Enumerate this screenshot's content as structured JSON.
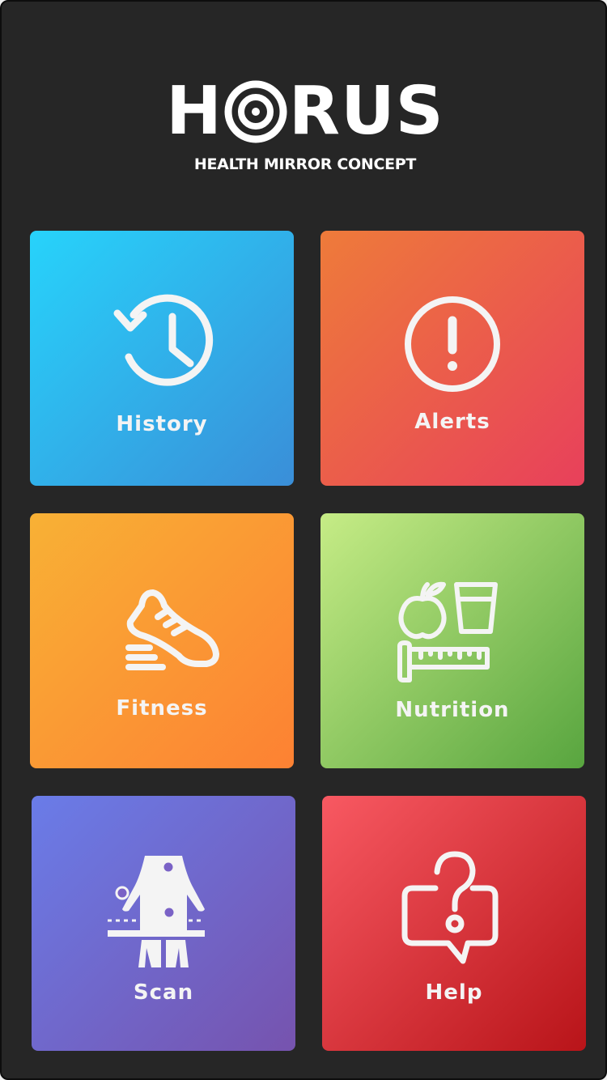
{
  "header": {
    "logo_left": "H",
    "logo_right": "RUS",
    "subtitle": "HEALTH MIRROR CONCEPT"
  },
  "tiles": [
    {
      "label": "History",
      "icon": "history-clock-icon",
      "gradient": [
        "#27d3fb",
        "#3a8ed8"
      ]
    },
    {
      "label": "Alerts",
      "icon": "alert-circle-icon",
      "gradient": [
        "#ee7b3a",
        "#e8405b"
      ]
    },
    {
      "label": "Fitness",
      "icon": "running-shoe-icon",
      "gradient": [
        "#f8b135",
        "#fd8133"
      ]
    },
    {
      "label": "Nutrition",
      "icon": "apple-glass-tape-icon",
      "gradient": [
        "#c6ec86",
        "#58a53f"
      ]
    },
    {
      "label": "Scan",
      "icon": "body-scan-icon",
      "gradient": [
        "#6a7ce8",
        "#7653ae"
      ]
    },
    {
      "label": "Help",
      "icon": "help-bubble-icon",
      "gradient": [
        "#f85962",
        "#b81419"
      ]
    }
  ],
  "colors": {
    "background": "#262626",
    "text": "#ffffff"
  }
}
